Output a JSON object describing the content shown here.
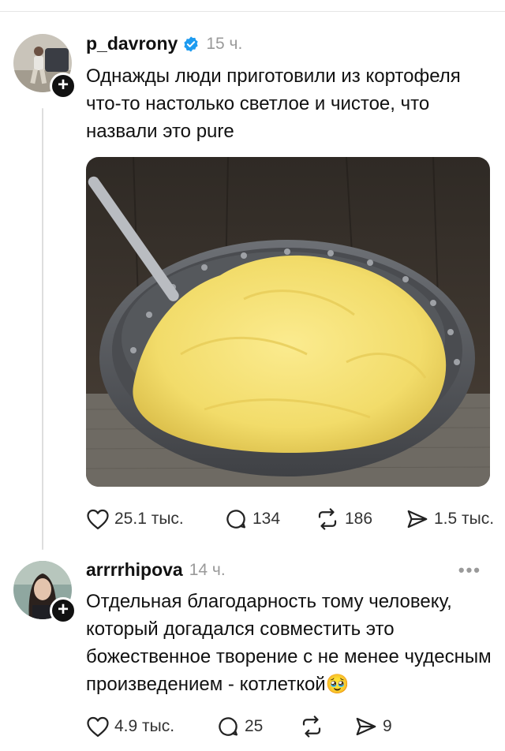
{
  "post1": {
    "username": "p_davrony",
    "time": "15 ч.",
    "text": "Однажды люди приготовили из кортофеля что-то настолько светлое и чистое, что назвали это pure",
    "likes": "25.1 тыс.",
    "comments": "134",
    "reposts": "186",
    "shares": "1.5 тыс."
  },
  "post2": {
    "username": "arrrrhipova",
    "time": "14 ч.",
    "text": "Отдельная благодарность тому человеку, который догадался совместить это божественное творение с не менее чудесным произведением - котлеткой",
    "emoji": "🥹",
    "more": "•••",
    "likes": "4.9 тыс.",
    "comments": "25",
    "reposts": "",
    "shares": "9"
  },
  "colors": {
    "verified": "#1d9bf0",
    "puree": "#f2dc6a",
    "bowl": "#5a5c60"
  },
  "icons": [
    "verified-badge-icon",
    "plus-icon",
    "heart-icon",
    "comment-icon",
    "repost-icon",
    "share-icon",
    "more-icon"
  ]
}
